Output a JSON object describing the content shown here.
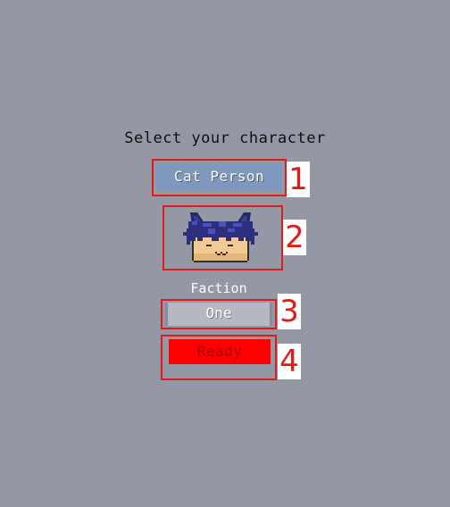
{
  "screen": {
    "title": "Select your character"
  },
  "character": {
    "name": "Cat Person",
    "portrait_icon": "cat-person-portrait-icon"
  },
  "faction": {
    "label": "Faction",
    "value": "One"
  },
  "ready": {
    "label": "Ready"
  },
  "annotations": {
    "n1": "1",
    "n2": "2",
    "n3": "3",
    "n4": "4"
  },
  "colors": {
    "background": "#9497a4",
    "name_button": "#7f98bd",
    "faction_button": "#b6b7c1",
    "ready_button": "#fe0000",
    "annotation": "#e01b1b"
  }
}
